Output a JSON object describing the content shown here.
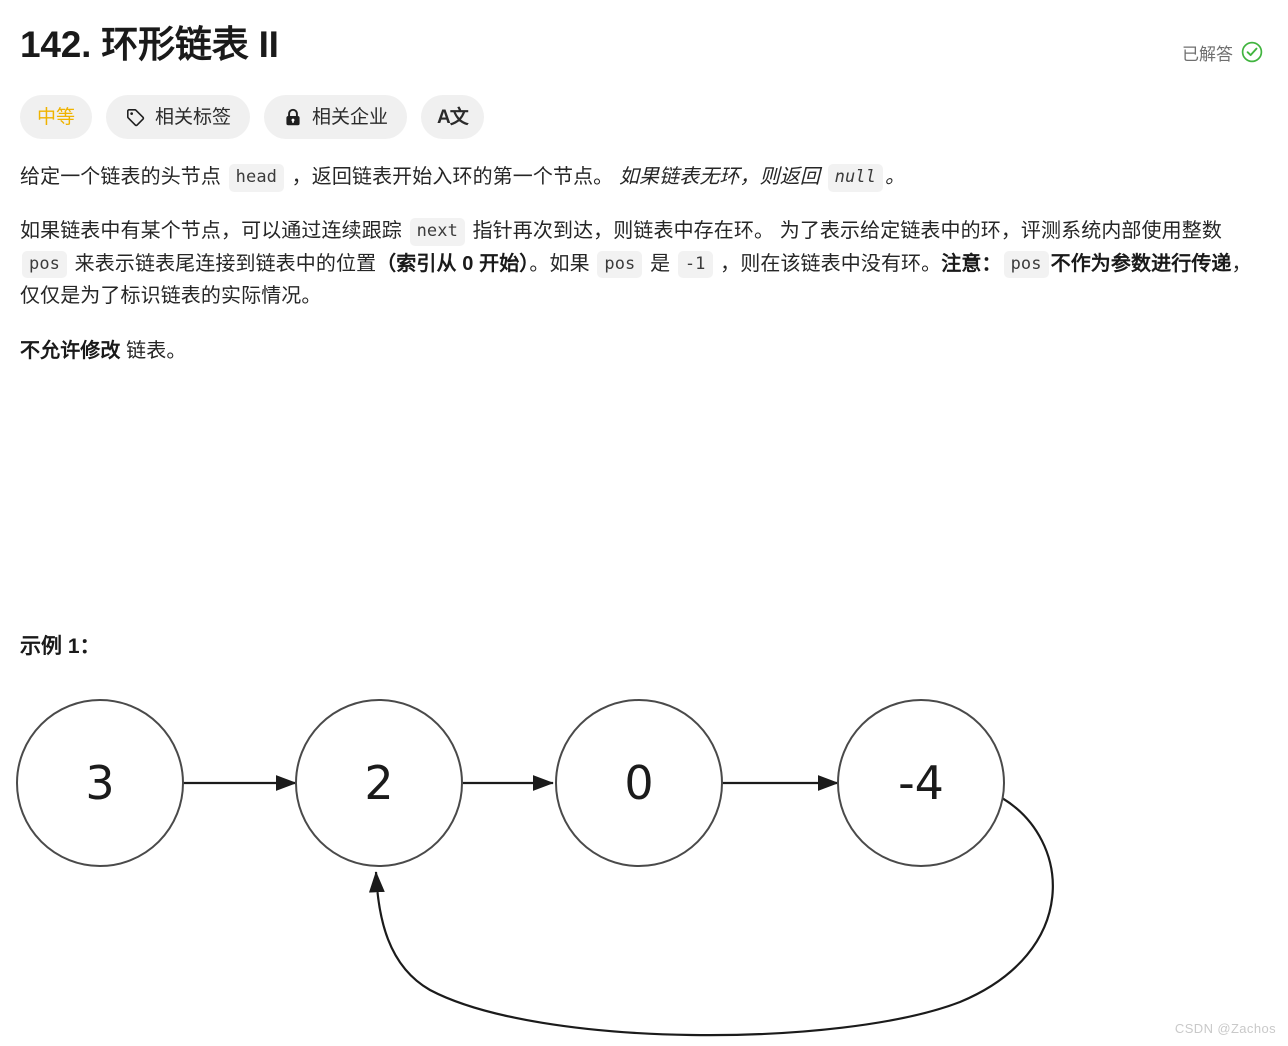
{
  "header": {
    "title": "142. 环形链表 II",
    "status_label": "已解答",
    "status_icon": "check-circle-icon",
    "status_color": "#41b43f"
  },
  "pills": {
    "difficulty": {
      "label": "中等",
      "color": "#efb300"
    },
    "tags": {
      "label": "相关标签",
      "icon": "tag-icon"
    },
    "companies": {
      "label": "相关企业",
      "icon": "lock-icon"
    },
    "translate": {
      "label": "A文",
      "icon": "translate-icon"
    }
  },
  "description": {
    "p1": {
      "t1": "给定一个链表的头节点 ",
      "code1": "head",
      "t2": " ，返回链表开始入环的第一个节点。 ",
      "italic1": "如果链表无环，则返回 ",
      "code2": "null",
      "italic2": "。"
    },
    "p2": {
      "t1": "如果链表中有某个节点，可以通过连续跟踪 ",
      "code1": "next",
      "t2": " 指针再次到达，则链表中存在环。 为了表示给定链表中的环，评测系统内部使用整数 ",
      "code2": "pos",
      "t3": " 来表示链表尾连接到链表中的位置",
      "bold1": "（索引从 0 开始）",
      "t4": "。如果 ",
      "code3": "pos",
      "t5": " 是 ",
      "code4": "-1",
      "t6": " ，则在该链表中没有环。",
      "bold2": "注意：",
      "code5": "pos",
      "bold3": "不作为参数进行传递",
      "t7": "，仅仅是为了标识链表的实际情况。"
    },
    "p3": {
      "bold1": "不允许修改",
      "t1": " 链表。"
    }
  },
  "example": {
    "heading": "示例 1：",
    "nodes": [
      "3",
      "2",
      "0",
      "-4"
    ],
    "cycle_from": "-4",
    "cycle_to": "2"
  },
  "watermark": "CSDN @Zachos"
}
